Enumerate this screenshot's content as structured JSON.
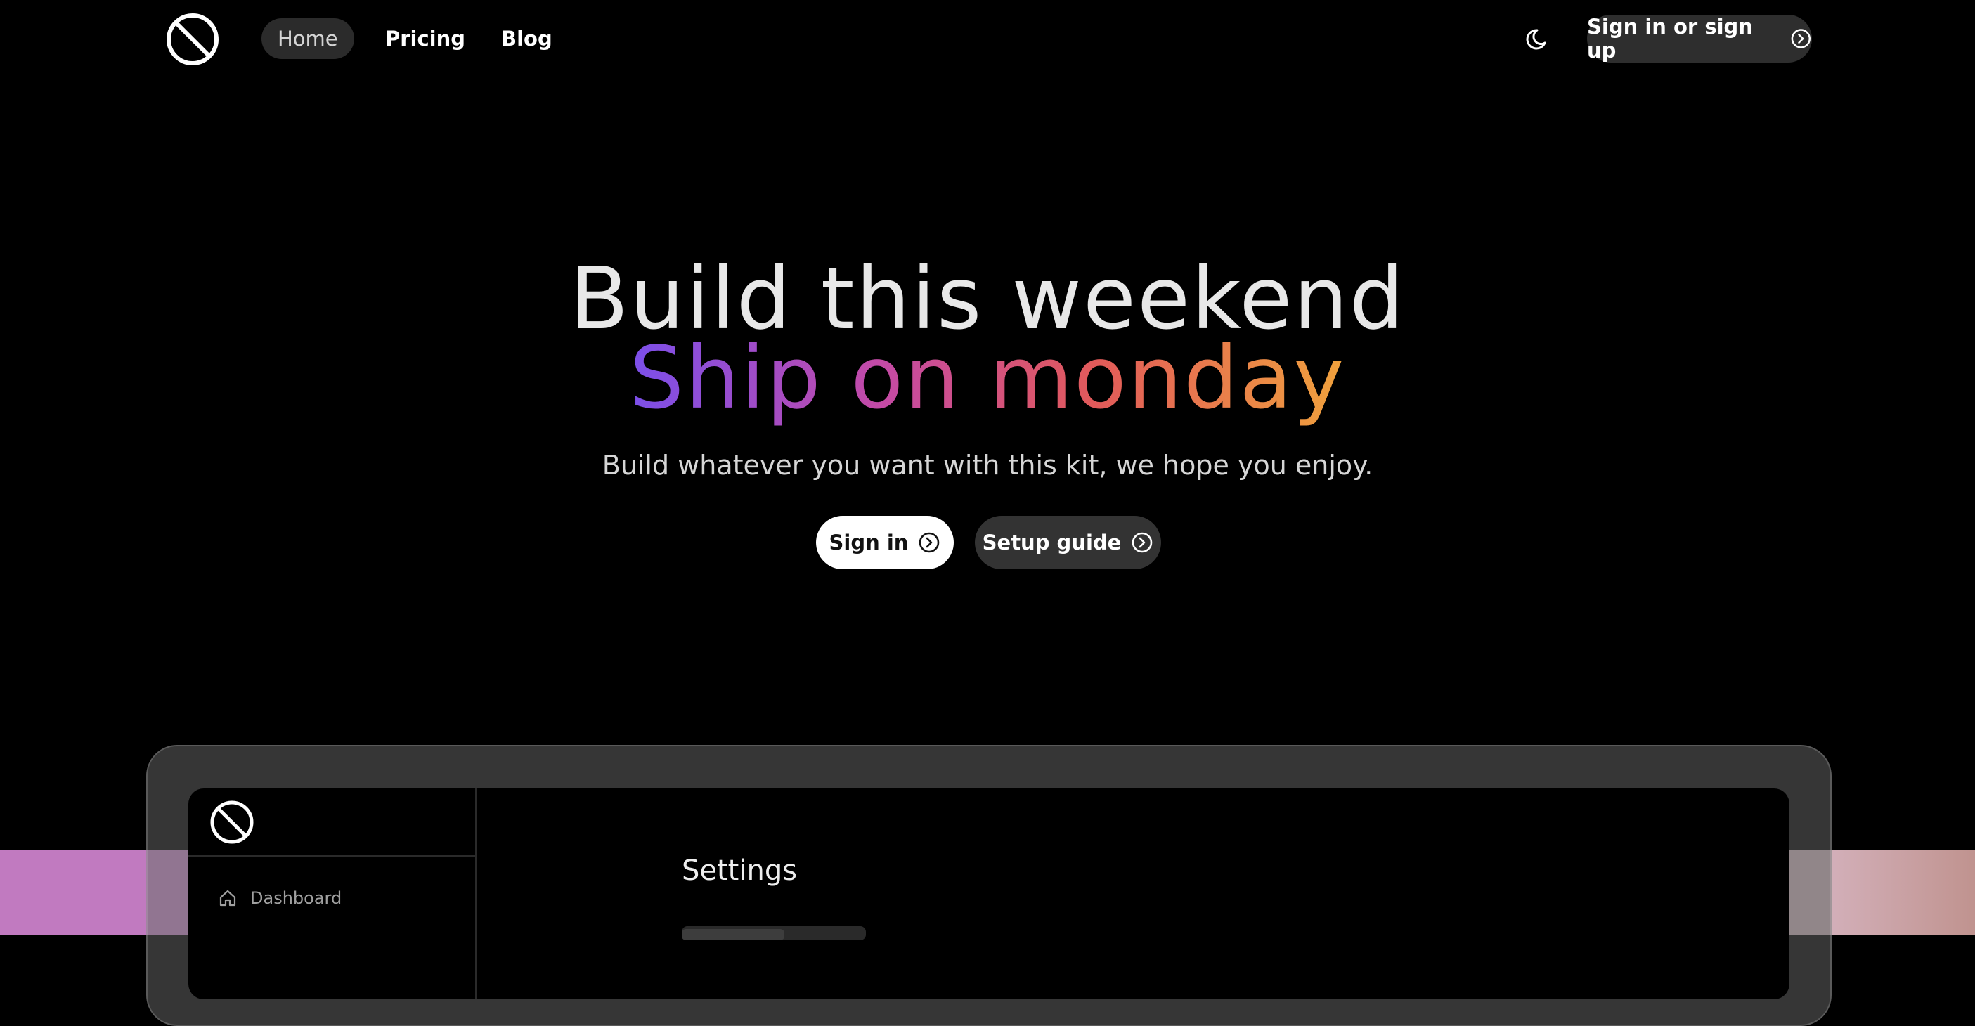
{
  "nav": {
    "logo_icon": "circle-slash-logo",
    "links": [
      {
        "label": "Home",
        "active": true
      },
      {
        "label": "Pricing",
        "active": false
      },
      {
        "label": "Blog",
        "active": false
      }
    ],
    "theme_icon": "moon-icon",
    "signup_label": "Sign in or sign up"
  },
  "hero": {
    "line1": "Build this weekend",
    "line2": "Ship on monday",
    "subtitle": "Build whatever you want with this kit, we hope you enjoy.",
    "primary_cta": "Sign in",
    "secondary_cta": "Setup guide"
  },
  "preview": {
    "sidebar_items": [
      {
        "label": "Dashboard",
        "icon": "home-icon"
      }
    ],
    "page_title": "Settings"
  },
  "colors": {
    "background": "#000000",
    "gradient": [
      "#7b4fea",
      "#c44aa6",
      "#e25a5a",
      "#f0a23c"
    ]
  }
}
